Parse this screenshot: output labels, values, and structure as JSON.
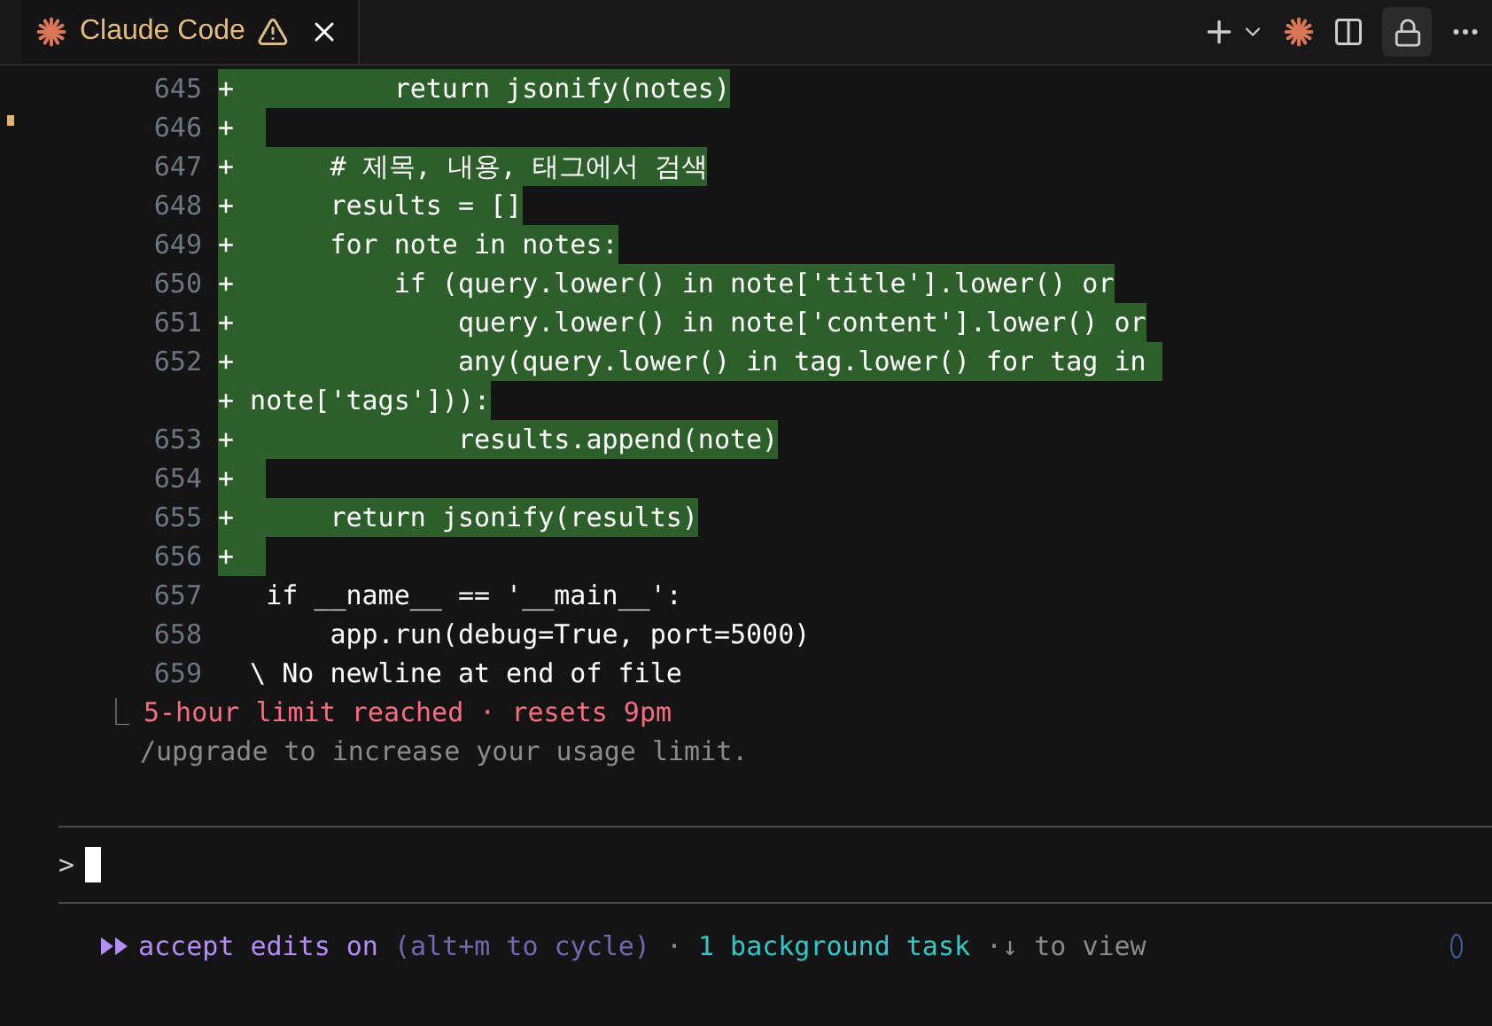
{
  "tab": {
    "title": "Claude Code",
    "warning": true
  },
  "diff_lines": [
    {
      "number": "645",
      "kind": "added",
      "sign": "+",
      "text": "          return jsonify(notes)"
    },
    {
      "number": "646",
      "kind": "added",
      "sign": "+"
    },
    {
      "number": "647",
      "kind": "added",
      "sign": "+",
      "text": "      # 제목, 내용, 태그에서 검색"
    },
    {
      "number": "648",
      "kind": "added",
      "sign": "+",
      "text": "      results = []"
    },
    {
      "number": "649",
      "kind": "added",
      "sign": "+",
      "text": "      for note in notes:"
    },
    {
      "number": "650",
      "kind": "added",
      "sign": "+",
      "text": "          if (query.lower() in note['title'].lower() or"
    },
    {
      "number": "651",
      "kind": "added",
      "sign": "+",
      "text": "              query.lower() in note['content'].lower() or"
    },
    {
      "number": "652",
      "kind": "added",
      "sign": "+",
      "text": "              any(query.lower() in tag.lower() for tag in "
    },
    {
      "kind": "continuation",
      "sign": "+",
      "text": " note['tags'])):"
    },
    {
      "number": "653",
      "kind": "added",
      "sign": "+",
      "text": "              results.append(note)"
    },
    {
      "number": "654",
      "kind": "added",
      "sign": "+"
    },
    {
      "number": "655",
      "kind": "added",
      "sign": "+",
      "text": "      return jsonify(results)"
    },
    {
      "number": "656",
      "kind": "added",
      "sign": "+"
    },
    {
      "number": "657",
      "kind": "context",
      "text": "  if __name__ == '__main__':"
    },
    {
      "number": "658",
      "kind": "context",
      "text": "      app.run(debug=True, port=5000)"
    },
    {
      "number": "659",
      "kind": "context",
      "text": " \\ No newline at end of file"
    }
  ],
  "result": {
    "corner": "⎿",
    "message": "5-hour limit reached · resets 9pm",
    "hint": "/upgrade to increase your usage limit."
  },
  "prompt": {
    "symbol": ">"
  },
  "footer": {
    "mode": "accept edits on",
    "mode_hint": "(alt+m to cycle)",
    "separator": "·",
    "tasks": "1 background task",
    "tasks_hint": "·↓ to view"
  }
}
